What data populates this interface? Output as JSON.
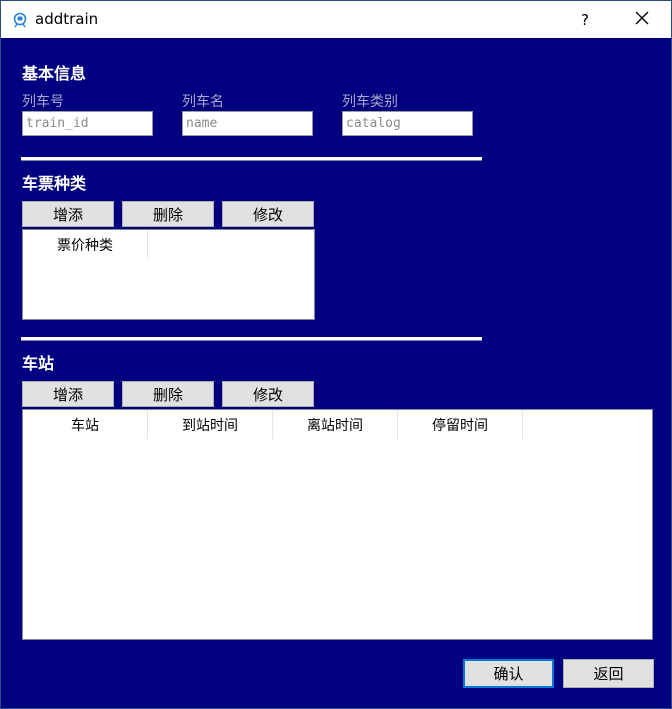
{
  "window": {
    "title": "addtrain",
    "help_label": "?",
    "close_label": "✕"
  },
  "basic_info": {
    "heading": "基本信息",
    "fields": [
      {
        "label": "列车号",
        "placeholder": "train_id"
      },
      {
        "label": "列车名",
        "placeholder": "name"
      },
      {
        "label": "列车类别",
        "placeholder": "catalog"
      }
    ]
  },
  "ticket_types": {
    "heading": "车票种类",
    "buttons": {
      "add": "增添",
      "delete": "删除",
      "edit": "修改"
    },
    "columns": [
      "票价种类"
    ]
  },
  "stations": {
    "heading": "车站",
    "buttons": {
      "add": "增添",
      "delete": "删除",
      "edit": "修改"
    },
    "columns": [
      "车站",
      "到站时间",
      "离站时间",
      "停留时间"
    ]
  },
  "footer": {
    "confirm": "确认",
    "back": "返回"
  },
  "colors": {
    "background": "#000080",
    "primary_border": "#0078d7"
  }
}
